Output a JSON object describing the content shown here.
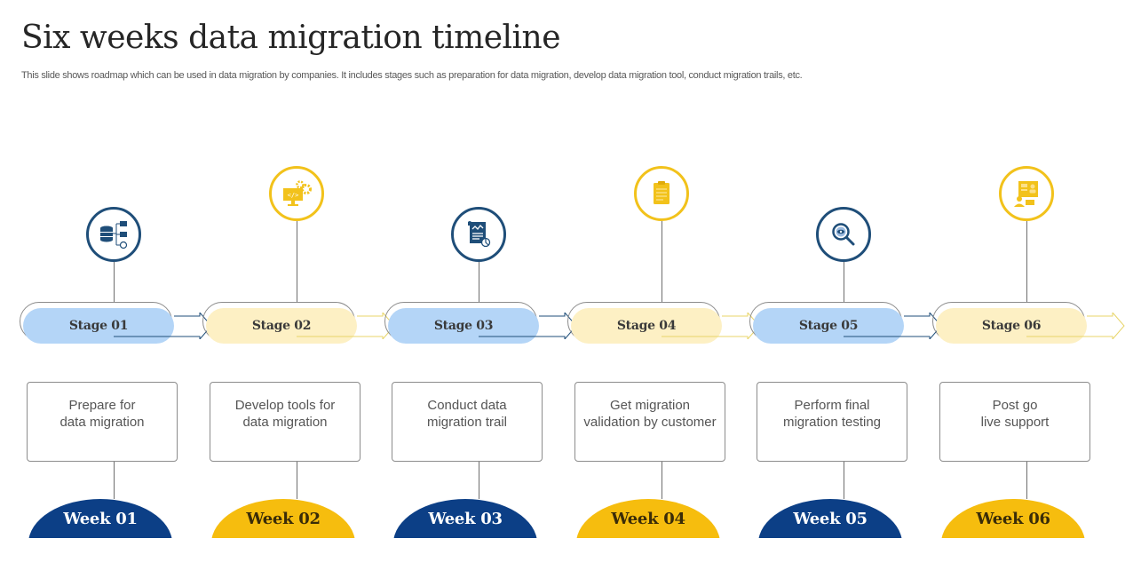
{
  "header": {
    "title": "Six weeks data migration timeline",
    "subtitle": "This slide shows roadmap which can be used in data migration by companies. It includes stages such as preparation for data migration, develop data migration tool, conduct migration trails, etc."
  },
  "colors": {
    "blue_dark": "#1f4e79",
    "blue_week": "#0c3f86",
    "blue_pill": "#b4d5f7",
    "yellow": "#f2c21b",
    "yellow_week": "#f6bd0e",
    "yellow_pill": "#fdf0c4"
  },
  "stages": [
    {
      "stage": "Stage 01",
      "description": "Prepare for\ndata migration",
      "week": "Week 01",
      "theme": "blue",
      "icon": "database-hierarchy-icon"
    },
    {
      "stage": "Stage 02",
      "description": "Develop tools for\ndata migration",
      "week": "Week 02",
      "theme": "yellow",
      "icon": "monitor-code-gears-icon"
    },
    {
      "stage": "Stage 03",
      "description": "Conduct data\nmigration trail",
      "week": "Week 03",
      "theme": "blue",
      "icon": "document-chart-icon"
    },
    {
      "stage": "Stage 04",
      "description": "Get migration\nvalidation by customer",
      "week": "Week 04",
      "theme": "yellow",
      "icon": "clipboard-icon"
    },
    {
      "stage": "Stage 05",
      "description": "Perform final\nmigration testing",
      "week": "Week 05",
      "theme": "blue",
      "icon": "magnifier-eye-icon"
    },
    {
      "stage": "Stage 06",
      "description": "Post go\nlive support",
      "week": "Week 06",
      "theme": "yellow",
      "icon": "support-dashboard-icon"
    }
  ]
}
